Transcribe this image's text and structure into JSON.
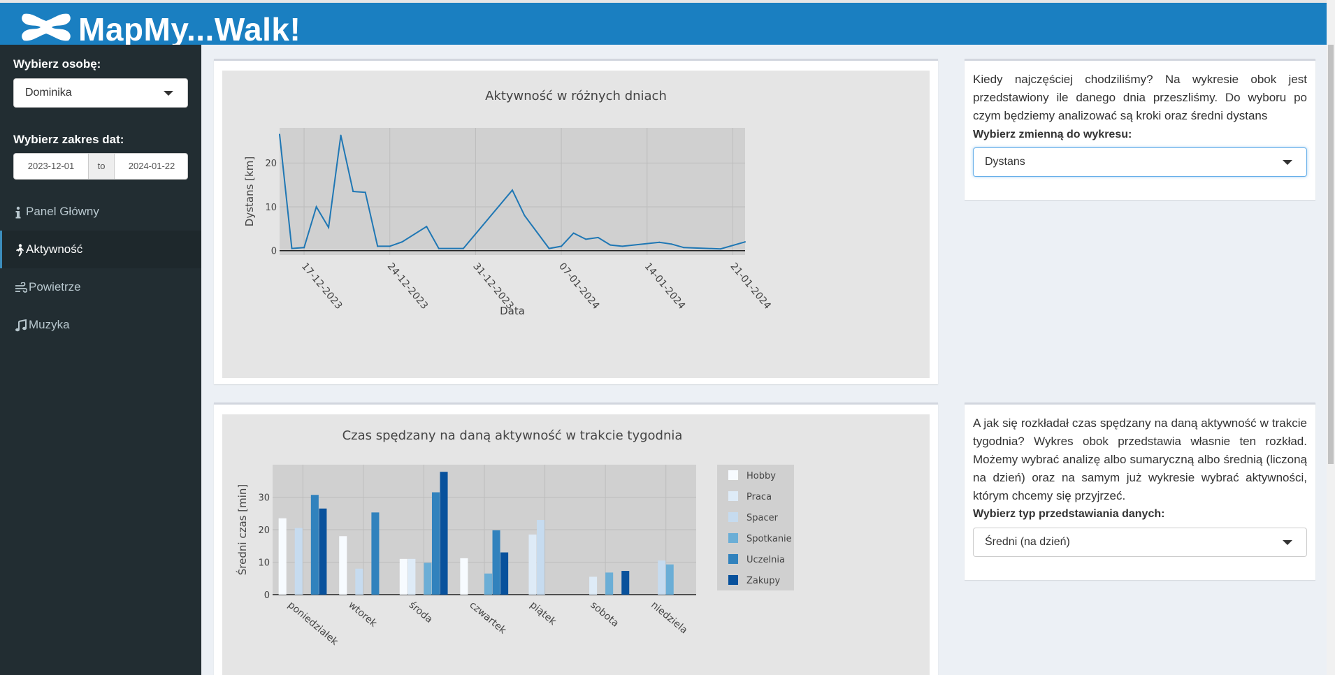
{
  "app": {
    "brand": "MapMy...Walk!"
  },
  "sidebar": {
    "person_label": "Wybierz osobę:",
    "person_value": "Dominika",
    "date_label": "Wybierz zakres dat:",
    "date_start": "2023-12-01",
    "date_sep": "to",
    "date_end": "2024-01-22",
    "menu": [
      {
        "label": "Panel Główny",
        "icon": "info-icon"
      },
      {
        "label": "Aktywność",
        "icon": "walking-icon",
        "active": true
      },
      {
        "label": "Powietrze",
        "icon": "wind-icon"
      },
      {
        "label": "Muzyka",
        "icon": "music-icon"
      }
    ]
  },
  "panel1": {
    "text": "Kiedy najczęściej chodziliśmy? Na wykresie obok jest przedstawiony ile danego dnia przeszliśmy. Do wyboru po czym będziemy analizować są kroki oraz średni dystans",
    "select_label": "Wybierz zmienną do wykresu:",
    "select_value": "Dystans"
  },
  "panel2": {
    "text": "A jak się rozkładał czas spędzany na daną aktywność w trakcie tygodnia? Wykres obok przedstawia własnie ten rozkład. Możemy wybrać analizę albo sumaryczną albo średnią (liczoną na dzień) oraz na samym już wykresie wybrać aktywności, którym chcemy się przyjrzeć.",
    "select_label": "Wybierz typ przedstawiania danych:",
    "select_value": "Średni (na dzień)"
  },
  "chart_data": [
    {
      "type": "line",
      "title": "Aktywność w różnych dniach",
      "xlabel": "Data",
      "ylabel": "Dystans [km]",
      "x_ticks": [
        "17-12-2023",
        "24-12-2023",
        "31-12-2023",
        "07-01-2024",
        "14-01-2024",
        "21-01-2024"
      ],
      "y_ticks": [
        0,
        10,
        20
      ],
      "ylim": [
        -1,
        28
      ],
      "xlim": [
        "2023-12-15",
        "2024-01-22"
      ],
      "color": "#1f77b4",
      "x": [
        "2023-12-15",
        "2023-12-16",
        "2023-12-17",
        "2023-12-18",
        "2023-12-19",
        "2023-12-20",
        "2023-12-21",
        "2023-12-22",
        "2023-12-23",
        "2023-12-24",
        "2023-12-25",
        "2023-12-27",
        "2023-12-28",
        "2023-12-30",
        "2024-01-03",
        "2024-01-04",
        "2024-01-06",
        "2024-01-07",
        "2024-01-08",
        "2024-01-09",
        "2024-01-10",
        "2024-01-11",
        "2024-01-12",
        "2024-01-15",
        "2024-01-16",
        "2024-01-17",
        "2024-01-20",
        "2024-01-22"
      ],
      "y": [
        26.5,
        0.5,
        0.7,
        10,
        5.3,
        26.3,
        13.5,
        13.3,
        1,
        1,
        2,
        5.5,
        0.5,
        0.5,
        13.8,
        8,
        0.5,
        1,
        4,
        2.6,
        3,
        1.3,
        1,
        1.9,
        1.5,
        0.7,
        0.4,
        2
      ]
    },
    {
      "type": "bar",
      "title": "Czas spędzany na daną aktywność w trakcie tygodnia",
      "ylabel": "Średni czas [min]",
      "y_ticks": [
        0,
        10,
        20,
        30
      ],
      "ylim": [
        0,
        40
      ],
      "legend_position": "right",
      "categories": [
        "poniedziałek",
        "wtorek",
        "środa",
        "czwartek",
        "piątek",
        "sobota",
        "niedziela"
      ],
      "series": [
        {
          "name": "Hobby",
          "color": "#f7fbff",
          "values": [
            23.5,
            18,
            11,
            11.2,
            null,
            null,
            null
          ]
        },
        {
          "name": "Praca",
          "color": "#deebf7",
          "values": [
            null,
            null,
            11,
            null,
            18.5,
            5.5,
            null
          ]
        },
        {
          "name": "Spacer",
          "color": "#c6dbef",
          "values": [
            20.5,
            8,
            null,
            null,
            23,
            null,
            10.5
          ]
        },
        {
          "name": "Spotkanie",
          "color": "#6baed6",
          "values": [
            null,
            null,
            9.8,
            6.5,
            null,
            6.8,
            9.3
          ]
        },
        {
          "name": "Uczelnia",
          "color": "#3182bd",
          "values": [
            30.7,
            25.3,
            31.5,
            19.8,
            null,
            null,
            null
          ]
        },
        {
          "name": "Zakupy",
          "color": "#08519c",
          "values": [
            26.5,
            null,
            37.8,
            13,
            null,
            7.3,
            null
          ]
        }
      ]
    }
  ]
}
